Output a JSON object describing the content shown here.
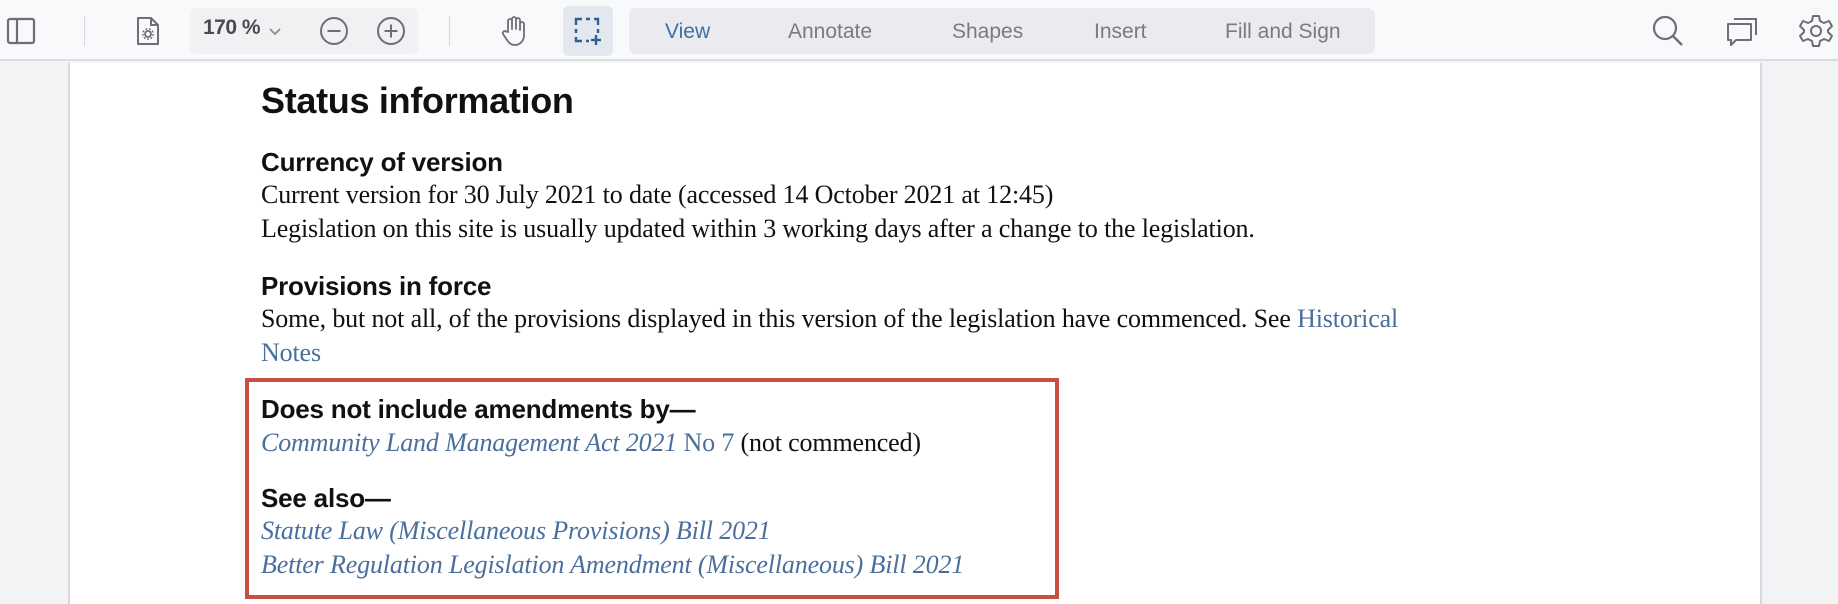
{
  "toolbar": {
    "zoom_value": "170 %",
    "mode_tabs": [
      {
        "label": "View",
        "active": true
      },
      {
        "label": "Annotate",
        "active": false
      },
      {
        "label": "Shapes",
        "active": false
      },
      {
        "label": "Insert",
        "active": false
      },
      {
        "label": "Fill and Sign",
        "active": false
      }
    ],
    "icons": {
      "left": [
        "sidebar-toggle-icon",
        "document-settings-icon",
        "zoom-out-icon",
        "zoom-in-icon",
        "hand-pan-icon",
        "marquee-select-icon"
      ],
      "right": [
        "search-icon",
        "comments-icon",
        "settings-gear-icon"
      ]
    },
    "colors": {
      "active_tab": "#3d6fa5",
      "highlight_border": "#c75140",
      "link": "#4a6f9c"
    }
  },
  "document": {
    "title": "Status information",
    "currency": {
      "heading": "Currency of version",
      "line1": "Current version for 30 July 2021 to date (accessed 14 October 2021 at 12:45)",
      "line2": "Legislation on this site is usually updated within 3 working days after a change to the legislation."
    },
    "provisions": {
      "heading": "Provisions in force",
      "text": "Some, but not all, of the provisions displayed in this version of the legislation have commenced. See ",
      "link_part1": "Historical",
      "link_part2": "Notes"
    },
    "amendments": {
      "heading": "Does not include amendments by—",
      "act_title": "Community Land Management Act 2021",
      "act_number": " No 7",
      "status": " (not commenced)"
    },
    "see_also": {
      "heading": "See also—",
      "items": [
        "Statute Law (Miscellaneous Provisions) Bill 2021",
        "Better Regulation Legislation Amendment (Miscellaneous) Bill 2021"
      ]
    }
  }
}
